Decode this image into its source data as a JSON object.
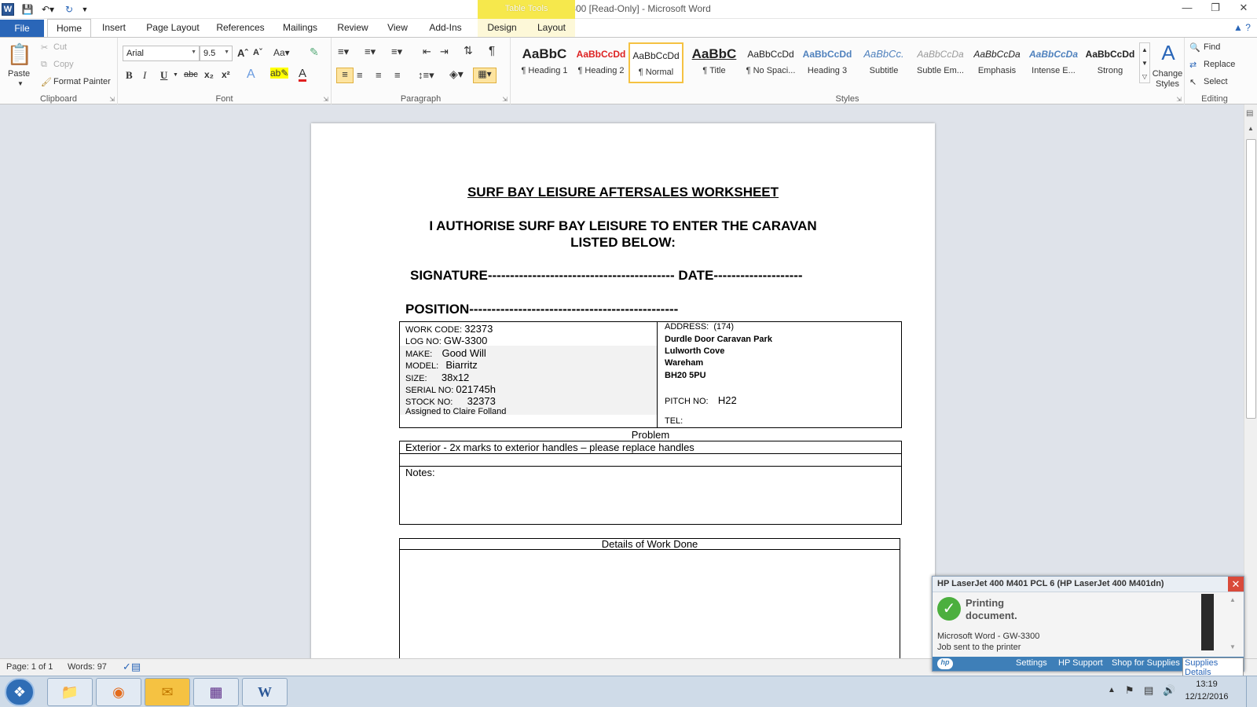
{
  "window": {
    "title": "GW-3300 [Read-Only]  -  Microsoft Word",
    "context_tab_group": "Table Tools",
    "app_icon_letter": "W"
  },
  "tabs": [
    "File",
    "Home",
    "Insert",
    "Page Layout",
    "References",
    "Mailings",
    "Review",
    "View",
    "Add-Ins",
    "Design",
    "Layout"
  ],
  "ribbon": {
    "clipboard": {
      "label": "Clipboard",
      "paste": "Paste",
      "cut": "Cut",
      "copy": "Copy",
      "format_painter": "Format Painter"
    },
    "font": {
      "label": "Font",
      "name": "Arial",
      "size": "9.5"
    },
    "paragraph": {
      "label": "Paragraph"
    },
    "styles": {
      "label": "Styles",
      "items": [
        {
          "sample": "AaBbC",
          "name": "¶ Heading 1"
        },
        {
          "sample": "AaBbCcDd",
          "name": "¶ Heading 2"
        },
        {
          "sample": "AaBbCcDd",
          "name": "¶ Normal"
        },
        {
          "sample": "AaBbC",
          "name": "¶ Title"
        },
        {
          "sample": "AaBbCcDd",
          "name": "¶ No Spaci..."
        },
        {
          "sample": "AaBbCcDd",
          "name": "Heading 3"
        },
        {
          "sample": "AaBbCc.",
          "name": "Subtitle"
        },
        {
          "sample": "AaBbCcDa",
          "name": "Subtle Em..."
        },
        {
          "sample": "AaBbCcDa",
          "name": "Emphasis"
        },
        {
          "sample": "AaBbCcDa",
          "name": "Intense E..."
        },
        {
          "sample": "AaBbCcDd",
          "name": "Strong"
        }
      ],
      "change_styles": "Change Styles"
    },
    "editing": {
      "label": "Editing",
      "find": "Find",
      "replace": "Replace",
      "select": "Select"
    }
  },
  "document": {
    "heading": "SURF BAY LEISURE AFTERSALES WORKSHEET",
    "authorise_line1": "I AUTHORISE SURF BAY LEISURE TO ENTER THE CARAVAN",
    "authorise_line2": "LISTED BELOW:",
    "signature_line": "SIGNATURE------------------------------------------ DATE--------------------",
    "position_line": "POSITION-----------------------------------------------",
    "details": {
      "work_code_label": "WORK CODE:",
      "work_code": "32373",
      "log_no_label": "LOG NO:",
      "log_no": "GW-3300",
      "make_label": "MAKE:",
      "make": "Good Will",
      "model_label": "MODEL:",
      "model": "Biarritz",
      "size_label": "SIZE:",
      "size": "38x12",
      "serial_label": "SERIAL  NO:",
      "serial": "021745h",
      "stock_label": "STOCK NO:",
      "stock": "32373",
      "assigned": "Assigned to Claire Folland"
    },
    "address": {
      "label": "ADDRESS:",
      "code": "(174)",
      "line1": "Durdle Door Caravan Park",
      "line2": "Lulworth Cove",
      "line3": "Wareham",
      "line4": "BH20 5PU",
      "pitch_label": "PITCH NO:",
      "pitch": "H22",
      "tel_label": "TEL:"
    },
    "problem_header": "Problem",
    "problem_text": "Exterior - 2x marks to exterior handles – please replace handles",
    "notes_label": "Notes:",
    "work_done_header": "Details of Work Done"
  },
  "statusbar": {
    "page": "Page: 1 of 1",
    "words": "Words: 97"
  },
  "printer_popup": {
    "title": "HP LaserJet 400 M401 PCL 6 (HP LaserJet 400 M401dn)",
    "status_line1": "Printing",
    "status_line2": "document.",
    "job_app": "Microsoft Word - GW-3300",
    "job_status": "Job sent to the printer",
    "links": [
      "Settings",
      "HP Support",
      "Shop for Supplies",
      "Supplies Details"
    ]
  },
  "taskbar": {
    "time": "13:19",
    "date": "12/12/2016"
  }
}
